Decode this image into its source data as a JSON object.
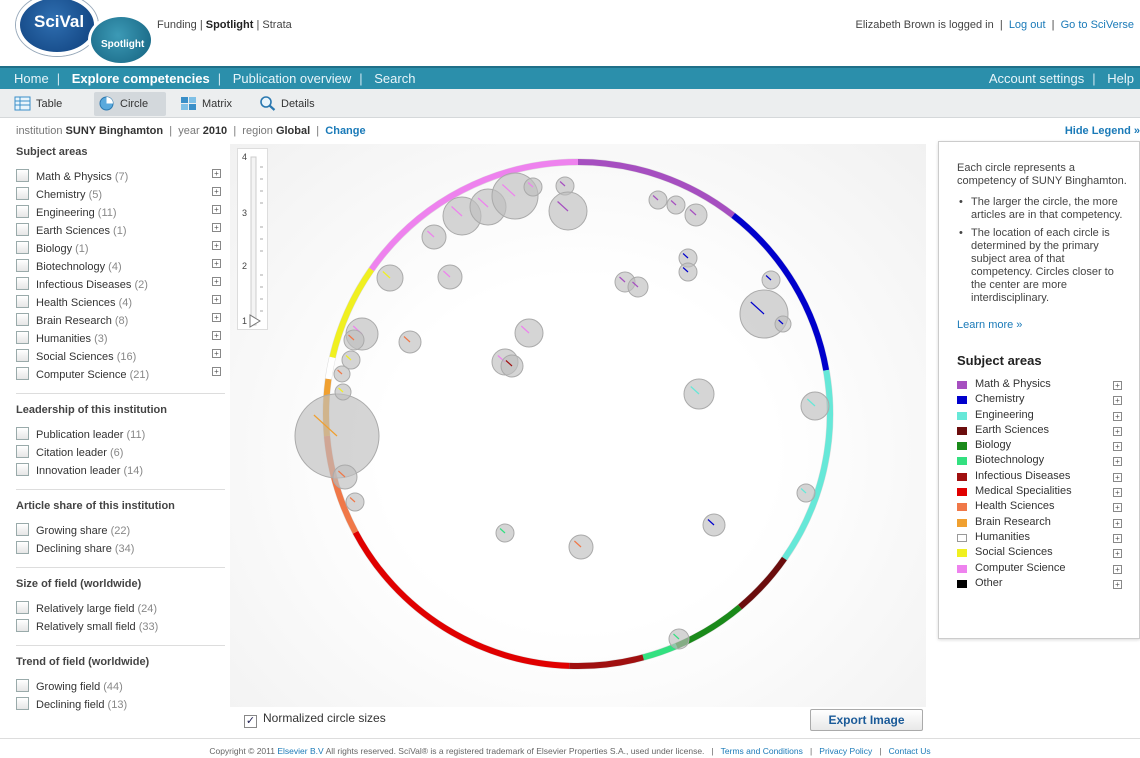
{
  "logo": {
    "main": "SciVal",
    "sub": "Spotlight"
  },
  "product_links": {
    "funding": "Funding",
    "spotlight": "Spotlight",
    "strata": "Strata",
    "sep": "|"
  },
  "user": {
    "logged_in": "Elizabeth Brown is logged in",
    "logout": "Log out",
    "goto": "Go to SciVerse",
    "sep": "|"
  },
  "nav": {
    "items": [
      "Home",
      "Explore competencies",
      "Publication overview",
      "Search"
    ],
    "active_index": 1,
    "right": [
      "Account settings",
      "Help"
    ],
    "sep": "|"
  },
  "view_tabs": [
    "Table",
    "Circle",
    "Matrix",
    "Details"
  ],
  "context": {
    "institution_label": "institution",
    "institution": "SUNY Binghamton",
    "year_label": "year",
    "year": "2010",
    "region_label": "region",
    "region": "Global",
    "change": "Change",
    "sep": "|"
  },
  "hide_legend": "Hide Legend »",
  "filters": {
    "subject_title": "Subject areas",
    "subject_items": [
      {
        "label": "Math & Physics",
        "count": "(7)"
      },
      {
        "label": "Chemistry",
        "count": "(5)"
      },
      {
        "label": "Engineering",
        "count": "(11)"
      },
      {
        "label": "Earth Sciences",
        "count": "(1)"
      },
      {
        "label": "Biology",
        "count": "(1)"
      },
      {
        "label": "Biotechnology",
        "count": "(4)"
      },
      {
        "label": "Infectious Diseases",
        "count": "(2)"
      },
      {
        "label": "Health Sciences",
        "count": "(4)"
      },
      {
        "label": "Brain Research",
        "count": "(8)"
      },
      {
        "label": "Humanities",
        "count": "(3)"
      },
      {
        "label": "Social Sciences",
        "count": "(16)"
      },
      {
        "label": "Computer Science",
        "count": "(21)"
      }
    ],
    "expand_glyph": "+",
    "leadership_title": "Leadership of this institution",
    "leadership_items": [
      {
        "label": "Publication leader",
        "count": "(11)"
      },
      {
        "label": "Citation leader",
        "count": "(6)"
      },
      {
        "label": "Innovation leader",
        "count": "(14)"
      }
    ],
    "share_title": "Article share of this institution",
    "share_items": [
      {
        "label": "Growing share",
        "count": "(22)"
      },
      {
        "label": "Declining share",
        "count": "(34)"
      }
    ],
    "size_title": "Size of field (worldwide)",
    "size_items": [
      {
        "label": "Relatively large field",
        "count": "(24)"
      },
      {
        "label": "Relatively small field",
        "count": "(33)"
      }
    ],
    "trend_title": "Trend of field (worldwide)",
    "trend_items": [
      {
        "label": "Growing field",
        "count": "(44)"
      },
      {
        "label": "Declining field",
        "count": "(13)"
      }
    ]
  },
  "slider": {
    "ticks": [
      "4",
      "3",
      "2",
      "1"
    ]
  },
  "normalized": {
    "label": "Normalized circle sizes",
    "checked": true,
    "check_glyph": "✓"
  },
  "export_label": "Export Image",
  "legend": {
    "intro": "Each circle represents a competency of SUNY Binghamton.",
    "bullets": [
      "The larger the circle, the more articles are in that competency.",
      "The location of each circle is determined by the primary subject area of that competency. Circles closer to the center are more interdisciplinary."
    ],
    "learn_more": "Learn more »",
    "subject_title": "Subject areas",
    "items": [
      {
        "label": "Math & Physics",
        "color": "#a64fc0"
      },
      {
        "label": "Chemistry",
        "color": "#0000cc"
      },
      {
        "label": "Engineering",
        "color": "#66e8d8"
      },
      {
        "label": "Earth Sciences",
        "color": "#6b0d0d"
      },
      {
        "label": "Biology",
        "color": "#1a8a1a"
      },
      {
        "label": "Biotechnology",
        "color": "#33e080"
      },
      {
        "label": "Infectious Diseases",
        "color": "#a01010"
      },
      {
        "label": "Medical Specialities",
        "color": "#e00000"
      },
      {
        "label": "Health Sciences",
        "color": "#f07848"
      },
      {
        "label": "Brain Research",
        "color": "#f0a030"
      },
      {
        "label": "Humanities",
        "color": "#ffffff"
      },
      {
        "label": "Social Sciences",
        "color": "#f0f020"
      },
      {
        "label": "Computer Science",
        "color": "#ee82ee"
      },
      {
        "label": "Other",
        "color": "#000000"
      }
    ]
  },
  "footer": {
    "copyright": "Copyright © 2011",
    "elsevier": "Elsevier B.V",
    "rights": "All rights reserved. SciVal® is a registered trademark of Elsevier Properties S.A., used under license.",
    "terms": "Terms and Conditions",
    "privacy": "Privacy Policy",
    "contact": "Contact Us",
    "sep": "|"
  }
}
